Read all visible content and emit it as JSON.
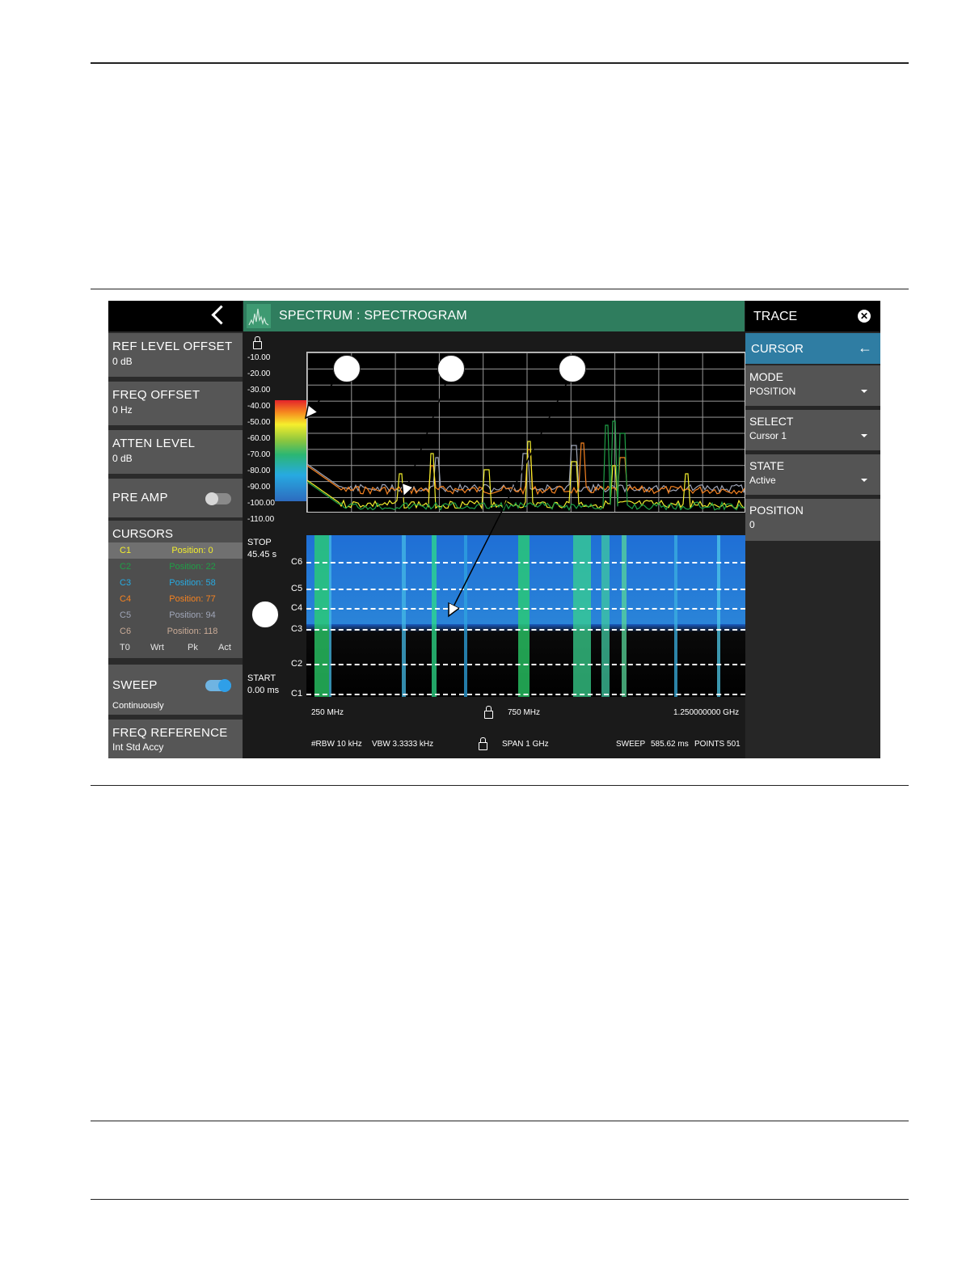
{
  "left_panel": {
    "ref_level_offset": {
      "label": "REF LEVEL OFFSET",
      "value": "0 dB"
    },
    "freq_offset": {
      "label": "FREQ OFFSET",
      "value": "0 Hz"
    },
    "atten_level": {
      "label": "ATTEN LEVEL",
      "value": "0 dB"
    },
    "pre_amp": {
      "label": "PRE AMP",
      "state": "off"
    },
    "cursors": {
      "title": "CURSORS",
      "items": [
        {
          "name": "C1",
          "position": "Position: 0",
          "color": "#f2ee2c"
        },
        {
          "name": "C2",
          "position": "Position: 22",
          "color": "#1f9f46"
        },
        {
          "name": "C3",
          "position": "Position: 58",
          "color": "#27aae1"
        },
        {
          "name": "C4",
          "position": "Position: 77",
          "color": "#f58220"
        },
        {
          "name": "C5",
          "position": "Position: 94",
          "color": "#a0a6b8"
        },
        {
          "name": "C6",
          "position": "Position: 118",
          "color": "#c8aa96"
        }
      ],
      "trace_flags": [
        "T0",
        "Wrt",
        "Pk",
        "Act"
      ]
    },
    "sweep": {
      "label": "SWEEP",
      "value": "Continuously",
      "state": "on"
    },
    "freq_reference": {
      "label": "FREQ REFERENCE",
      "value": "Int Std Accy"
    }
  },
  "main": {
    "title": "SPECTRUM : SPECTROGRAM",
    "y_ticks": [
      "-10.00",
      "-20.00",
      "-30.00",
      "-40.00",
      "-50.00",
      "-60.00",
      "-70.00",
      "-80.00",
      "-90.00",
      "-100.00",
      "-110.00"
    ],
    "stop_label": "STOP",
    "stop_value": "45.45 s",
    "start_label": "START",
    "start_value": "0.00 ms",
    "cursor_lines": [
      "C6",
      "C5",
      "C4",
      "C3",
      "C2",
      "C1"
    ],
    "freq_start": "250 MHz",
    "freq_center": "750 MHz",
    "freq_stop": "1.250000000 GHz",
    "rbw": "#RBW 10 kHz",
    "vbw": "VBW 3.3333 kHz",
    "span": "SPAN 1 GHz",
    "sweep_label": "SWEEP",
    "sweep_time": "585.62 ms",
    "points": "POINTS 501"
  },
  "right_panel": {
    "header": "TRACE",
    "section": "CURSOR",
    "mode": {
      "label": "MODE",
      "value": "POSITION"
    },
    "select": {
      "label": "SELECT",
      "value": "Cursor 1"
    },
    "state": {
      "label": "STATE",
      "value": "Active"
    },
    "position": {
      "label": "POSITION",
      "value": "0"
    }
  }
}
